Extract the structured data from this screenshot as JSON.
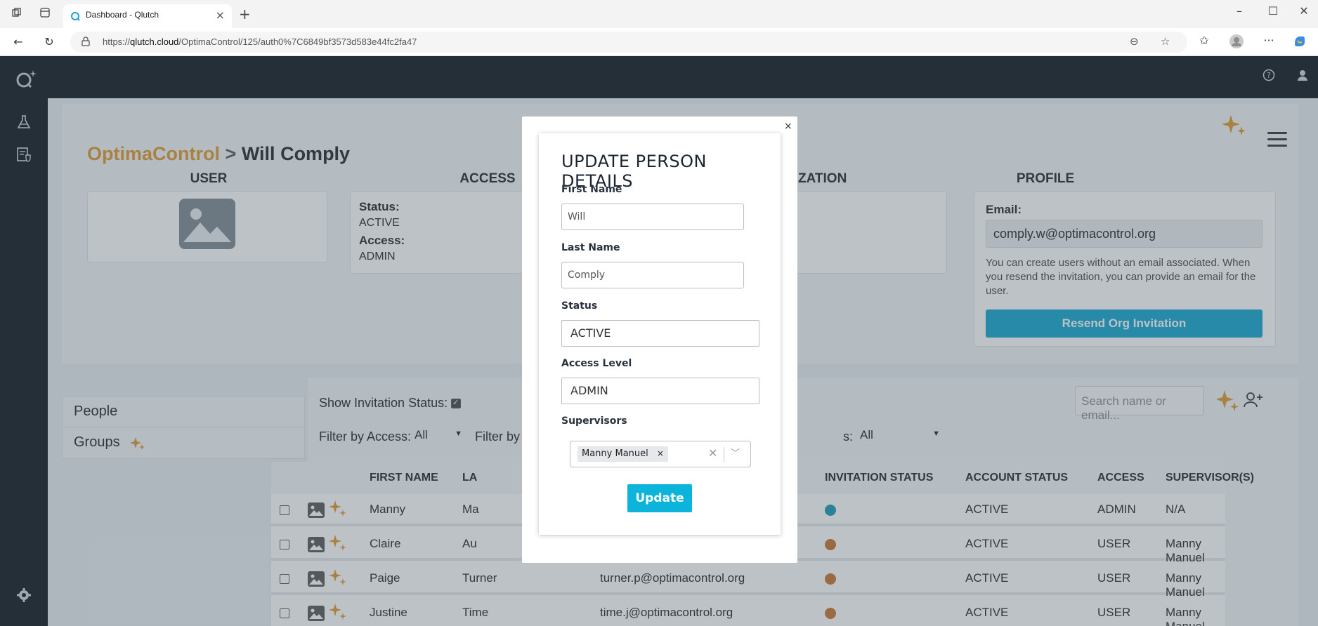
{
  "browser": {
    "tab_title": "Dashboard - Qlutch",
    "url_prefix": "https://",
    "url_domain": "qlutch.cloud",
    "url_path": "/OptimaControl/125/auth0%7C6849bf3573d583e44fc2fa47"
  },
  "header": {
    "breadcrumb_org": "OptimaControl",
    "breadcrumb_sep": ">",
    "breadcrumb_user": "Will Comply"
  },
  "sections": {
    "user": "USER",
    "access": "ACCESS",
    "organization_partial": "IZATION",
    "profile": "PROFILE"
  },
  "access_card": {
    "status_label": "Status:",
    "status_value": "ACTIVE",
    "access_label": "Access:",
    "access_value": "ADMIN"
  },
  "profile_card": {
    "email_label": "Email:",
    "email_value": "comply.w@optimacontrol.org",
    "hint": "You can create users without an email associated. When you resend the invitation, you can provide an email for the user.",
    "resend_label": "Resend Org Invitation"
  },
  "leftnav": {
    "people": "People",
    "groups": "Groups"
  },
  "panel": {
    "show_invitation": "Show Invitation Status:",
    "filter_access_label": "Filter by Access:",
    "filter_access_value": "All",
    "filter_by_partial": "Filter by",
    "filter_status_partial": "s:",
    "filter_status_value": "All",
    "search_placeholder": "Search name or email..."
  },
  "table": {
    "headers": {
      "first": "FIRST NAME",
      "last_partial": "LA",
      "invitation": "INVITATION STATUS",
      "account": "ACCOUNT STATUS",
      "access": "ACCESS",
      "supervisors": "SUPERVISOR(S)"
    },
    "rows": [
      {
        "first": "Manny",
        "last": "Ma",
        "email": "",
        "invite_color": "#1597b8",
        "account": "ACTIVE",
        "access": "ADMIN",
        "supervisor": "N/A"
      },
      {
        "first": "Claire",
        "last": "Au",
        "email": "",
        "invite_color": "#c8722c",
        "account": "ACTIVE",
        "access": "USER",
        "supervisor": "Manny Manuel"
      },
      {
        "first": "Paige",
        "last": "Turner",
        "email": "turner.p@optimacontrol.org",
        "invite_color": "#c8722c",
        "account": "ACTIVE",
        "access": "USER",
        "supervisor": "Manny Manuel"
      },
      {
        "first": "Justine",
        "last": "Time",
        "email": "time.j@optimacontrol.org",
        "invite_color": "#c8722c",
        "account": "ACTIVE",
        "access": "USER",
        "supervisor": "Manny Manuel"
      }
    ]
  },
  "modal": {
    "close": "×",
    "title": "UPDATE PERSON DETAILS",
    "first_name_label": "First Name",
    "first_name_value": "Will",
    "last_name_label": "Last Name",
    "last_name_value": "Comply",
    "status_label": "Status",
    "status_value": "ACTIVE",
    "access_label": "Access Level",
    "access_value": "ADMIN",
    "supervisors_label": "Supervisors",
    "supervisor_chip": "Manny Manuel",
    "chip_remove": "×",
    "update_label": "Update"
  },
  "colors": {
    "brand_orange": "#e0962a",
    "accent_blue": "#0ea5cf",
    "sidebar_dark": "#0c1219"
  }
}
